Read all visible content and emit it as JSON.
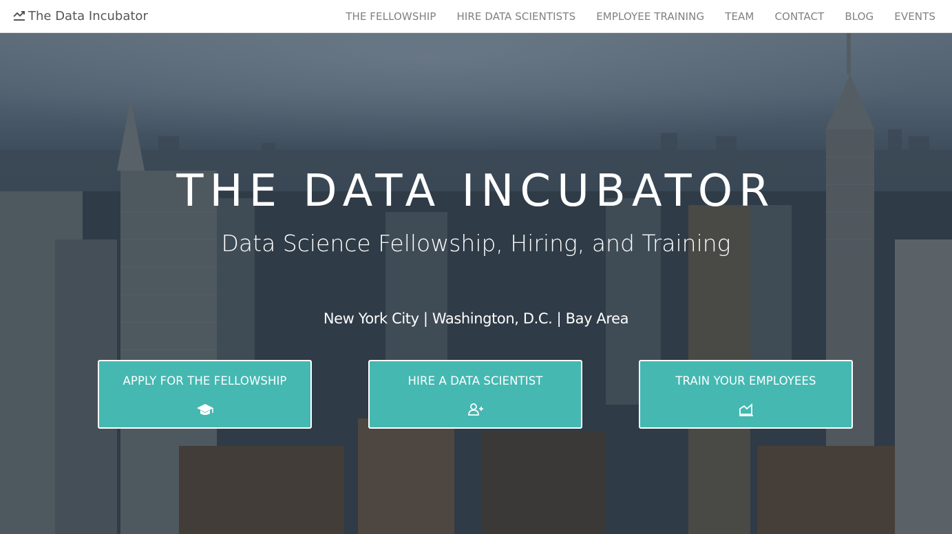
{
  "brand": {
    "name": "The Data Incubator",
    "icon": "line-chart-icon"
  },
  "nav": {
    "items": [
      {
        "label": "THE FELLOWSHIP"
      },
      {
        "label": "HIRE DATA SCIENTISTS"
      },
      {
        "label": "EMPLOYEE TRAINING"
      },
      {
        "label": "TEAM"
      },
      {
        "label": "CONTACT"
      },
      {
        "label": "BLOG"
      },
      {
        "label": "EVENTS"
      }
    ]
  },
  "hero": {
    "title": "THE DATA INCUBATOR",
    "subtitle": "Data Science Fellowship, Hiring, and Training",
    "cities": "New York City | Washington, D.C. | Bay Area",
    "background": "city skyline photo"
  },
  "cta": [
    {
      "label": "APPLY FOR THE FELLOWSHIP",
      "icon": "graduation-cap-icon"
    },
    {
      "label": "HIRE A DATA SCIENTIST",
      "icon": "user-plus-icon"
    },
    {
      "label": "TRAIN YOUR EMPLOYEES",
      "icon": "area-chart-icon"
    }
  ],
  "colors": {
    "accent": "#45b8b1",
    "nav_text": "#808080",
    "brand_text": "#555555"
  }
}
